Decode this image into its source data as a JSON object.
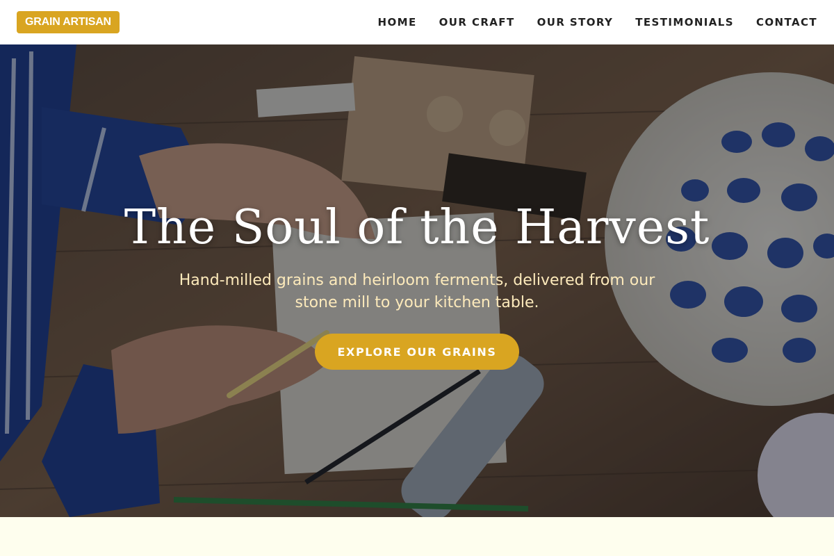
{
  "header": {
    "logo": "GRAIN ARTISAN",
    "nav": [
      {
        "label": "HOME"
      },
      {
        "label": "OUR CRAFT"
      },
      {
        "label": "OUR STORY"
      },
      {
        "label": "TESTIMONIALS"
      },
      {
        "label": "CONTACT"
      }
    ]
  },
  "hero": {
    "title": "The Soul of the Harvest",
    "subtitle": "Hand-milled grains and heirloom ferments, delivered from our stone mill to your kitchen table.",
    "cta": "EXPLORE OUR GRAINS"
  },
  "colors": {
    "accent": "#d9a521",
    "header_bg": "#ffffff",
    "page_bg": "#fefeee",
    "subtitle": "#fdeabb"
  }
}
